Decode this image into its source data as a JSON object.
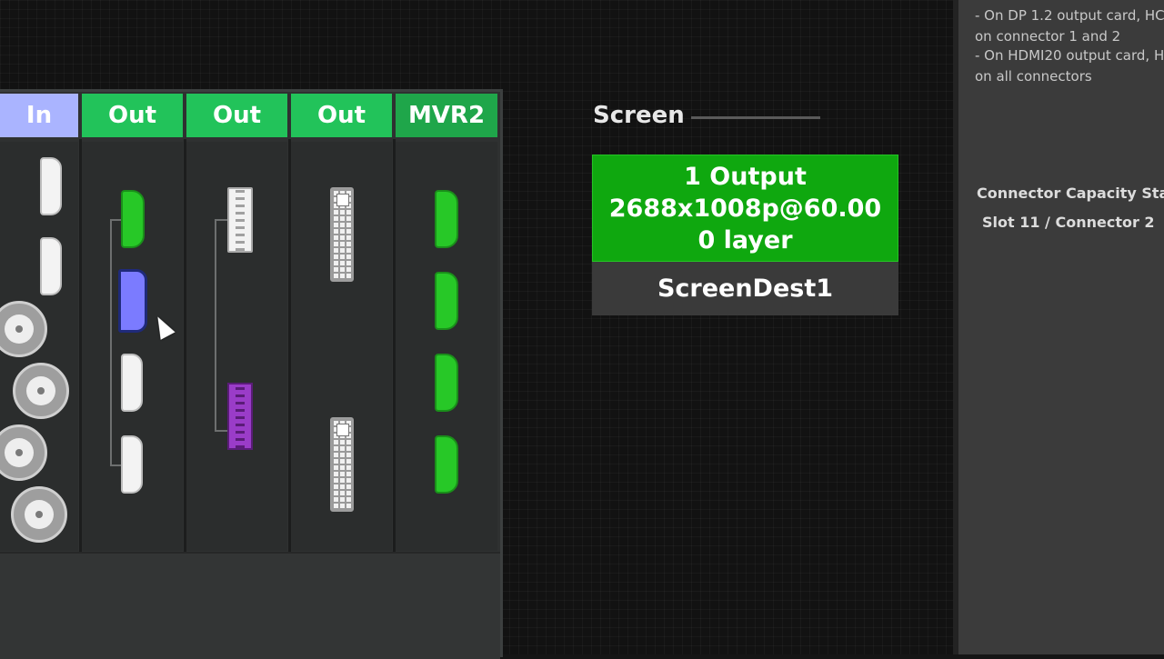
{
  "device": {
    "headers": [
      {
        "label": "In",
        "type": "input"
      },
      {
        "label": "Out",
        "type": "output"
      },
      {
        "label": "Out",
        "type": "output"
      },
      {
        "label": "Out",
        "type": "output"
      },
      {
        "label": "MVR2",
        "type": "multiviewer"
      }
    ],
    "connectors": {
      "in": [
        "hdmi-white",
        "hdmi-white",
        "sdi",
        "sdi",
        "sdi",
        "sdi"
      ],
      "out1": [
        "hdmi-green",
        "hdmi-blue-selected",
        "hdmi-white",
        "hdmi-white"
      ],
      "out2": [
        "displayport-white",
        "displayport-purple"
      ],
      "out3": [
        "dvi-white",
        "dvi-white"
      ],
      "mvr2": [
        "hdmi-green",
        "hdmi-green",
        "hdmi-green",
        "hdmi-green"
      ]
    },
    "colors": {
      "in_header": "#aab4ff",
      "out_header": "#22c35a",
      "mvr_header": "#1fa64a",
      "selected_connector": "#7b7bff",
      "purple_connector": "#9a3cc8"
    }
  },
  "screen": {
    "label": "Screen",
    "outputs": "1 Output",
    "resolution": "2688x1008p@60.00",
    "layers": "0 layer",
    "destination": "ScreenDest1",
    "color": "#0fa80f"
  },
  "info_panel": {
    "notes": [
      "- On DP 1.2 output card, HC",
      "on connector 1 and 2",
      "- On HDMI20 output card, H",
      "on all connectors"
    ],
    "capacity_title": "Connector Capacity Sta",
    "slot_connector": "Slot 11 / Connector 2"
  }
}
